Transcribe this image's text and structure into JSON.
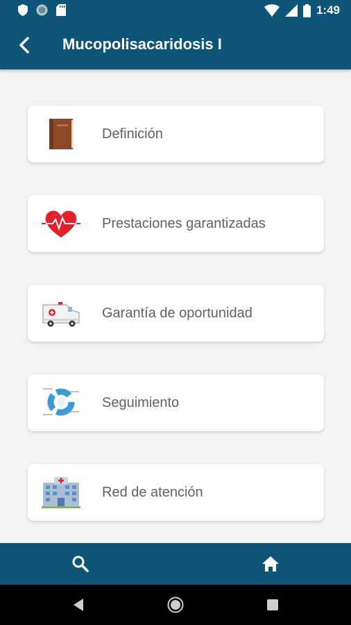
{
  "status_bar": {
    "time": "1:49",
    "icons": [
      "shield-icon",
      "circle-icon",
      "sd-card-icon",
      "wifi-icon",
      "signal-icon",
      "battery-icon"
    ]
  },
  "app_bar": {
    "title": "Mucopolisacaridosis I",
    "back_icon": "back-arrow-icon"
  },
  "menu": {
    "items": [
      {
        "label": "Definición",
        "icon": "book-icon"
      },
      {
        "label": "Prestaciones garantizadas",
        "icon": "heart-pulse-icon"
      },
      {
        "label": "Garantía de oportunidad",
        "icon": "ambulance-icon"
      },
      {
        "label": "Seguimiento",
        "icon": "donut-chart-icon"
      },
      {
        "label": "Red de atención",
        "icon": "hospital-icon"
      }
    ]
  },
  "bottom_nav": {
    "items": [
      "search-icon",
      "home-icon"
    ]
  },
  "colors": {
    "primary": "#0c5478",
    "background": "#f4f4f4",
    "card": "#ffffff",
    "label_text": "#616161"
  }
}
